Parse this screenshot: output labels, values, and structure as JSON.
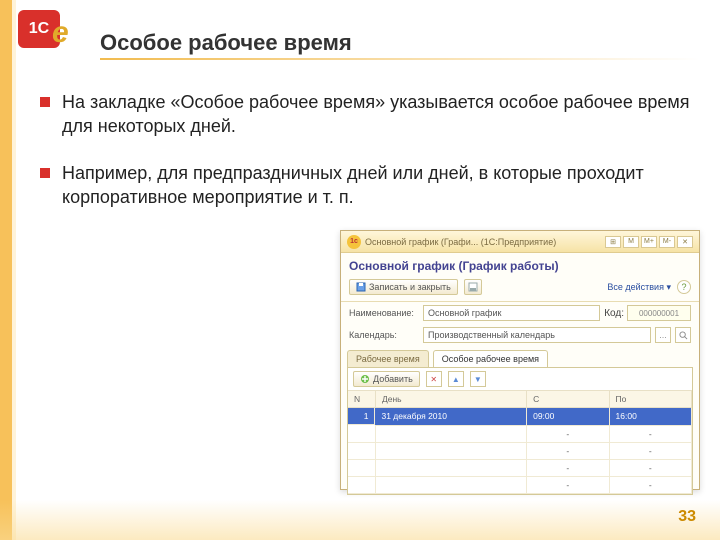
{
  "slide": {
    "title": "Особое рабочее время",
    "bullets": [
      "На закладке «Особое рабочее время» указывается особое рабочее время для некоторых дней.",
      "Например, для предпраздничных дней или дней, в которые проходит корпоративное мероприятие и т. п."
    ],
    "page": "33"
  },
  "app": {
    "window_caption": "Основной график (Графи... (1С:Предприятие)",
    "form_title": "Основной график (График работы)",
    "titlebar": {
      "m": "M",
      "m_plus": "M+",
      "m_minus": "M-"
    },
    "toolbar": {
      "save_and_close": "Записать и закрыть",
      "all_actions": "Все действия"
    },
    "fields": {
      "name_label": "Наименование:",
      "name_value": "Основной график",
      "code_label": "Код:",
      "code_value": "000000001",
      "calendar_label": "Календарь:",
      "calendar_value": "Производственный календарь"
    },
    "tabs": [
      "Рабочее время",
      "Особое рабочее время"
    ],
    "table": {
      "add_label": "Добавить",
      "columns": [
        "N",
        "День",
        "С",
        "По"
      ],
      "rows": [
        {
          "n": "1",
          "day": "31 декабря 2010",
          "from": "09:00",
          "to": "16:00"
        }
      ]
    }
  }
}
